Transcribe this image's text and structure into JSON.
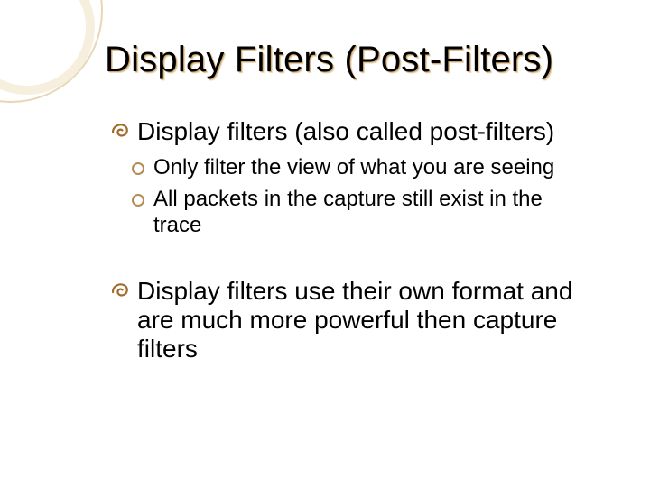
{
  "title": "Display Filters (Post-Filters)",
  "points": {
    "p1": "Display filters (also called post-filters)",
    "s1": "Only filter the view of what you are seeing",
    "s2": "All packets in the capture still exist in the trace",
    "p2": "Display filters use their own format and are much more powerful then capture filters"
  }
}
